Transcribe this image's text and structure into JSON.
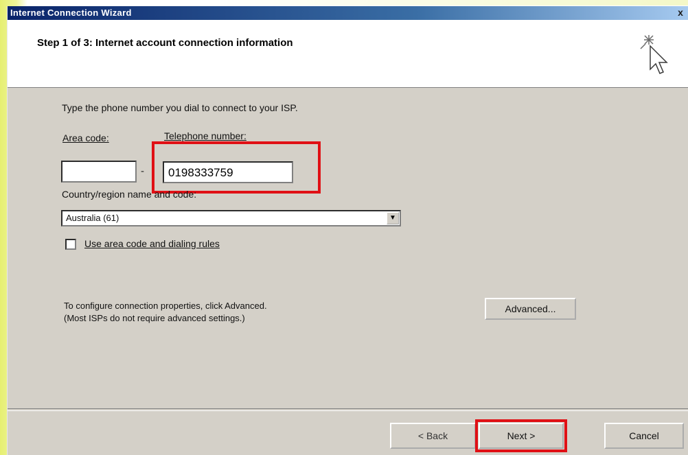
{
  "window": {
    "title": "Internet Connection Wizard",
    "close_symbol": "x"
  },
  "header": {
    "step_title": "Step 1 of 3: Internet account connection information"
  },
  "form": {
    "instruction": "Type the phone number you dial to connect to your ISP.",
    "area_code_label": "Area code:",
    "area_code_value": "",
    "telephone_label": "Telephone number:",
    "telephone_value": "0198333759",
    "dash": "-",
    "country_label": "Country/region name and code:",
    "country_value": "Australia (61)",
    "use_rules_label": "Use area code and dialing rules",
    "use_rules_checked": false
  },
  "advanced": {
    "text_line1": "To configure connection properties, click Advanced.",
    "text_line2": "(Most ISPs do not require advanced settings.)",
    "button_label": "Advanced..."
  },
  "footer": {
    "back_label": "< Back",
    "next_label": "Next >",
    "cancel_label": "Cancel"
  },
  "colors": {
    "highlight": "#e01015",
    "titlebar": "#0a246a",
    "dialog_bg": "#d4d0c8"
  },
  "icons": {
    "header": "wizard-cursor-sparkle-icon",
    "dropdown": "chevron-down-icon"
  }
}
